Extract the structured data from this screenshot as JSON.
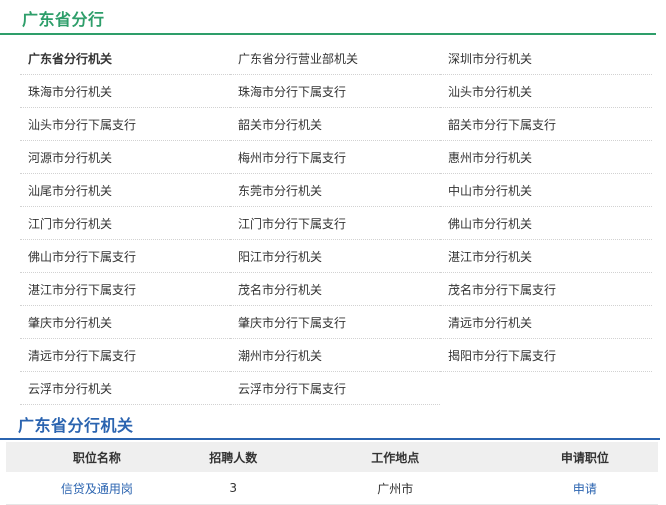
{
  "header": {
    "title": "广东省分行"
  },
  "branches": [
    "广东省分行机关",
    "广东省分行营业部机关",
    "深圳市分行机关",
    "珠海市分行机关",
    "珠海市分行下属支行",
    "汕头市分行机关",
    "汕头市分行下属支行",
    "韶关市分行机关",
    "韶关市分行下属支行",
    "河源市分行机关",
    "梅州市分行下属支行",
    "惠州市分行机关",
    "汕尾市分行机关",
    "东莞市分行机关",
    "中山市分行机关",
    "江门市分行机关",
    "江门市分行下属支行",
    "佛山市分行机关",
    "佛山市分行下属支行",
    "阳江市分行机关",
    "湛江市分行机关",
    "湛江市分行下属支行",
    "茂名市分行机关",
    "茂名市分行下属支行",
    "肇庆市分行机关",
    "肇庆市分行下属支行",
    "清远市分行机关",
    "清远市分行下属支行",
    "潮州市分行机关",
    "揭阳市分行下属支行",
    "云浮市分行机关",
    "云浮市分行下属支行"
  ],
  "section": {
    "title": "广东省分行机关"
  },
  "jobs_table": {
    "headers": {
      "name": "职位名称",
      "count": "招聘人数",
      "location": "工作地点",
      "apply": "申请职位"
    },
    "rows": [
      {
        "name": "信贷及通用岗",
        "count": "3",
        "location": "广州市",
        "apply": "申请"
      }
    ]
  }
}
